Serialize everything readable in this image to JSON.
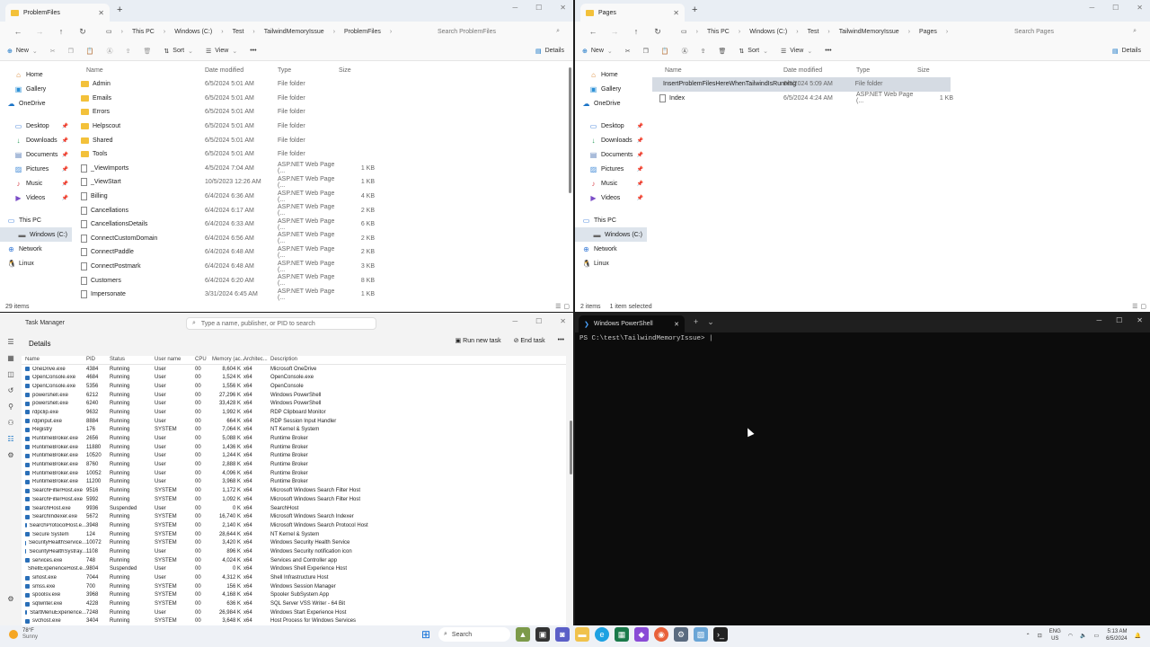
{
  "explorer1": {
    "tab_title": "ProblemFiles",
    "breadcrumb": [
      "This PC",
      "Windows (C:)",
      "Test",
      "TailwindMemoryIssue",
      "ProblemFiles"
    ],
    "search_placeholder": "Search ProblemFiles",
    "cmd": {
      "new": "New",
      "sort": "Sort",
      "view": "View",
      "details": "Details"
    },
    "nav": [
      "Home",
      "Gallery",
      "OneDrive",
      "Desktop",
      "Downloads",
      "Documents",
      "Pictures",
      "Music",
      "Videos",
      "This PC",
      "Windows (C:)",
      "Network",
      "Linux"
    ],
    "columns": [
      "Name",
      "Date modified",
      "Type",
      "Size"
    ],
    "rows": [
      {
        "name": "Admin",
        "date": "6/5/2024 5:01 AM",
        "type": "File folder",
        "size": "",
        "kind": "folder"
      },
      {
        "name": "Emails",
        "date": "6/5/2024 5:01 AM",
        "type": "File folder",
        "size": "",
        "kind": "folder"
      },
      {
        "name": "Errors",
        "date": "6/5/2024 5:01 AM",
        "type": "File folder",
        "size": "",
        "kind": "folder"
      },
      {
        "name": "Helpscout",
        "date": "6/5/2024 5:01 AM",
        "type": "File folder",
        "size": "",
        "kind": "folder"
      },
      {
        "name": "Shared",
        "date": "6/5/2024 5:01 AM",
        "type": "File folder",
        "size": "",
        "kind": "folder"
      },
      {
        "name": "Tools",
        "date": "6/5/2024 5:01 AM",
        "type": "File folder",
        "size": "",
        "kind": "folder"
      },
      {
        "name": "_ViewImports",
        "date": "4/5/2024 7:04 AM",
        "type": "ASP.NET Web Page (...",
        "size": "1 KB",
        "kind": "page"
      },
      {
        "name": "_ViewStart",
        "date": "10/5/2023 12:26 AM",
        "type": "ASP.NET Web Page (...",
        "size": "1 KB",
        "kind": "page"
      },
      {
        "name": "Billing",
        "date": "6/4/2024 6:36 AM",
        "type": "ASP.NET Web Page (...",
        "size": "4 KB",
        "kind": "page"
      },
      {
        "name": "Cancellations",
        "date": "6/4/2024 6:17 AM",
        "type": "ASP.NET Web Page (...",
        "size": "2 KB",
        "kind": "page"
      },
      {
        "name": "CancellationsDetails",
        "date": "6/4/2024 6:33 AM",
        "type": "ASP.NET Web Page (...",
        "size": "6 KB",
        "kind": "page"
      },
      {
        "name": "ConnectCustomDomain",
        "date": "6/4/2024 6:56 AM",
        "type": "ASP.NET Web Page (...",
        "size": "2 KB",
        "kind": "page"
      },
      {
        "name": "ConnectPaddle",
        "date": "6/4/2024 6:48 AM",
        "type": "ASP.NET Web Page (...",
        "size": "2 KB",
        "kind": "page"
      },
      {
        "name": "ConnectPostmark",
        "date": "6/4/2024 6:48 AM",
        "type": "ASP.NET Web Page (...",
        "size": "3 KB",
        "kind": "page"
      },
      {
        "name": "Customers",
        "date": "6/4/2024 6:20 AM",
        "type": "ASP.NET Web Page (...",
        "size": "8 KB",
        "kind": "page"
      },
      {
        "name": "Impersonate",
        "date": "3/31/2024 6:45 AM",
        "type": "ASP.NET Web Page (...",
        "size": "1 KB",
        "kind": "page"
      }
    ],
    "status": "29 items"
  },
  "explorer2": {
    "tab_title": "Pages",
    "breadcrumb": [
      "This PC",
      "Windows (C:)",
      "Test",
      "TailwindMemoryIssue",
      "Pages"
    ],
    "search_placeholder": "Search Pages",
    "cmd": {
      "new": "New",
      "sort": "Sort",
      "view": "View",
      "details": "Details"
    },
    "nav": [
      "Home",
      "Gallery",
      "OneDrive",
      "Desktop",
      "Downloads",
      "Documents",
      "Pictures",
      "Music",
      "Videos",
      "This PC",
      "Windows (C:)",
      "Network",
      "Linux"
    ],
    "columns": [
      "Name",
      "Date modified",
      "Type",
      "Size"
    ],
    "rows": [
      {
        "name": "InsertProblemFilesHereWhenTailwindIsRunning",
        "date": "6/5/2024 5:09 AM",
        "type": "File folder",
        "size": "",
        "kind": "folder",
        "selected": true
      },
      {
        "name": "Index",
        "date": "6/5/2024 4:24 AM",
        "type": "ASP.NET Web Page (...",
        "size": "1 KB",
        "kind": "page"
      }
    ],
    "status": "2 items",
    "selection": "1 item selected"
  },
  "taskmanager": {
    "title": "Task Manager",
    "search_placeholder": "Type a name, publisher, or PID to search",
    "section": "Details",
    "run_new_task": "Run new task",
    "end_task": "End task",
    "columns": [
      "Name",
      "PID",
      "Status",
      "User name",
      "CPU",
      "Memory (ac...",
      "Architec...",
      "Description"
    ],
    "rows": [
      [
        "OneDrive.exe",
        "4384",
        "Running",
        "User",
        "00",
        "8,604 K",
        "x64",
        "Microsoft OneDrive"
      ],
      [
        "OpenConsole.exe",
        "4684",
        "Running",
        "User",
        "00",
        "1,524 K",
        "x64",
        "OpenConsole.exe"
      ],
      [
        "OpenConsole.exe",
        "5356",
        "Running",
        "User",
        "00",
        "1,556 K",
        "x64",
        "OpenConsole"
      ],
      [
        "powershell.exe",
        "6212",
        "Running",
        "User",
        "00",
        "27,296 K",
        "x64",
        "Windows PowerShell"
      ],
      [
        "powershell.exe",
        "6240",
        "Running",
        "User",
        "00",
        "33,428 K",
        "x64",
        "Windows PowerShell"
      ],
      [
        "rdpclip.exe",
        "9632",
        "Running",
        "User",
        "00",
        "1,992 K",
        "x64",
        "RDP Clipboard Monitor"
      ],
      [
        "rdpinput.exe",
        "8884",
        "Running",
        "User",
        "00",
        "664 K",
        "x64",
        "RDP Session Input Handler"
      ],
      [
        "Registry",
        "176",
        "Running",
        "SYSTEM",
        "00",
        "7,064 K",
        "x64",
        "NT Kernel & System"
      ],
      [
        "RuntimeBroker.exe",
        "2656",
        "Running",
        "User",
        "00",
        "5,088 K",
        "x64",
        "Runtime Broker"
      ],
      [
        "RuntimeBroker.exe",
        "11880",
        "Running",
        "User",
        "00",
        "1,436 K",
        "x64",
        "Runtime Broker"
      ],
      [
        "RuntimeBroker.exe",
        "10520",
        "Running",
        "User",
        "00",
        "1,244 K",
        "x64",
        "Runtime Broker"
      ],
      [
        "RuntimeBroker.exe",
        "8760",
        "Running",
        "User",
        "00",
        "2,888 K",
        "x64",
        "Runtime Broker"
      ],
      [
        "RuntimeBroker.exe",
        "10052",
        "Running",
        "User",
        "00",
        "4,096 K",
        "x64",
        "Runtime Broker"
      ],
      [
        "RuntimeBroker.exe",
        "11200",
        "Running",
        "User",
        "00",
        "3,968 K",
        "x64",
        "Runtime Broker"
      ],
      [
        "SearchFilterHost.exe",
        "9516",
        "Running",
        "SYSTEM",
        "00",
        "1,172 K",
        "x64",
        "Microsoft Windows Search Filter Host"
      ],
      [
        "SearchFilterHost.exe",
        "5992",
        "Running",
        "SYSTEM",
        "00",
        "1,092 K",
        "x64",
        "Microsoft Windows Search Filter Host"
      ],
      [
        "SearchHost.exe",
        "9936",
        "Suspended",
        "User",
        "00",
        "0 K",
        "x64",
        "SearchHost"
      ],
      [
        "SearchIndexer.exe",
        "5672",
        "Running",
        "SYSTEM",
        "00",
        "16,740 K",
        "x64",
        "Microsoft Windows Search Indexer"
      ],
      [
        "SearchProtocolHost.e...",
        "3948",
        "Running",
        "SYSTEM",
        "00",
        "2,140 K",
        "x64",
        "Microsoft Windows Search Protocol Host"
      ],
      [
        "Secure System",
        "124",
        "Running",
        "SYSTEM",
        "00",
        "28,644 K",
        "x64",
        "NT Kernel & System"
      ],
      [
        "SecurityHealthService...",
        "10072",
        "Running",
        "SYSTEM",
        "00",
        "3,420 K",
        "x64",
        "Windows Security Health Service"
      ],
      [
        "SecurityHealthSystray...",
        "1108",
        "Running",
        "User",
        "00",
        "896 K",
        "x64",
        "Windows Security notification icon"
      ],
      [
        "services.exe",
        "748",
        "Running",
        "SYSTEM",
        "00",
        "4,024 K",
        "x64",
        "Services and Controller app"
      ],
      [
        "ShellExperienceHost.e...",
        "9804",
        "Suspended",
        "User",
        "00",
        "0 K",
        "x64",
        "Windows Shell Experience Host"
      ],
      [
        "sihost.exe",
        "7044",
        "Running",
        "User",
        "00",
        "4,312 K",
        "x64",
        "Shell Infrastructure Host"
      ],
      [
        "smss.exe",
        "700",
        "Running",
        "SYSTEM",
        "00",
        "156 K",
        "x64",
        "Windows Session Manager"
      ],
      [
        "spoolsv.exe",
        "3968",
        "Running",
        "SYSTEM",
        "00",
        "4,168 K",
        "x64",
        "Spooler SubSystem App"
      ],
      [
        "sqlwriter.exe",
        "4228",
        "Running",
        "SYSTEM",
        "00",
        "636 K",
        "x64",
        "SQL Server VSS Writer - 64 Bit"
      ],
      [
        "StartMenuExperience...",
        "7248",
        "Running",
        "User",
        "00",
        "26,984 K",
        "x64",
        "Windows Start Experience Host"
      ],
      [
        "svchost.exe",
        "3404",
        "Running",
        "SYSTEM",
        "00",
        "3,648 K",
        "x64",
        "Host Process for Windows Services"
      ]
    ]
  },
  "powershell": {
    "tab_title": "Windows PowerShell",
    "prompt": "PS C:\\test\\TailwindMemoryIssue> |"
  },
  "taskbar": {
    "weather_temp": "78°F",
    "weather_desc": "Sunny",
    "search": "Search",
    "lang1": "ENG",
    "lang2": "US",
    "time": "5:13 AM",
    "date": "6/5/2024"
  }
}
